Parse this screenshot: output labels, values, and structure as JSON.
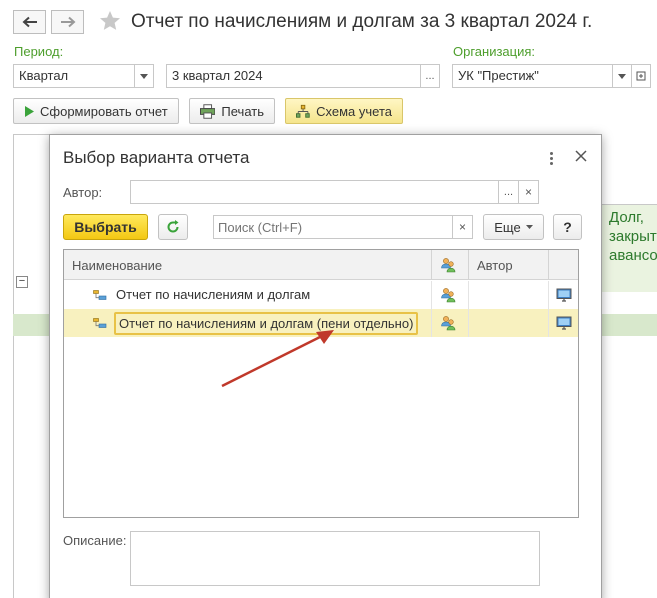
{
  "header": {
    "title": "Отчет по начислениям и долгам за 3 квартал 2024 г.",
    "back_icon": "arrow-left-icon",
    "forward_icon": "arrow-right-icon",
    "favorite_icon": "star-icon"
  },
  "filters": {
    "period_label": "Период:",
    "period_type_value": "Квартал",
    "period_value": "3 квартал 2024",
    "org_label": "Организация:",
    "org_value": "УК \"Престиж\""
  },
  "toolbar": {
    "generate_label": "Сформировать отчет",
    "print_label": "Печать",
    "scheme_label": "Схема учета"
  },
  "background_table": {
    "header_text_lines": [
      "Долг,",
      "закрыт",
      "авансо"
    ]
  },
  "dialog": {
    "title": "Выбор варианта отчета",
    "author_label": "Автор:",
    "author_value": "",
    "select_label": "Выбрать",
    "search_placeholder": "Поиск (Ctrl+F)",
    "more_label": "Еще",
    "help_label": "?",
    "columns": {
      "name": "Наименование",
      "author": "Автор"
    },
    "rows": [
      {
        "name": "Отчет по начислениям и долгам",
        "author": "",
        "selected": false
      },
      {
        "name": "Отчет по начислениям и долгам (пени отдельно)",
        "author": "",
        "selected": true
      }
    ],
    "description_label": "Описание:",
    "description_value": ""
  },
  "colors": {
    "accent_green": "#4d9e2c",
    "select_yellow": "#f3c813",
    "selected_row": "#f8f1bf",
    "annotation_arrow": "#c0392b"
  }
}
